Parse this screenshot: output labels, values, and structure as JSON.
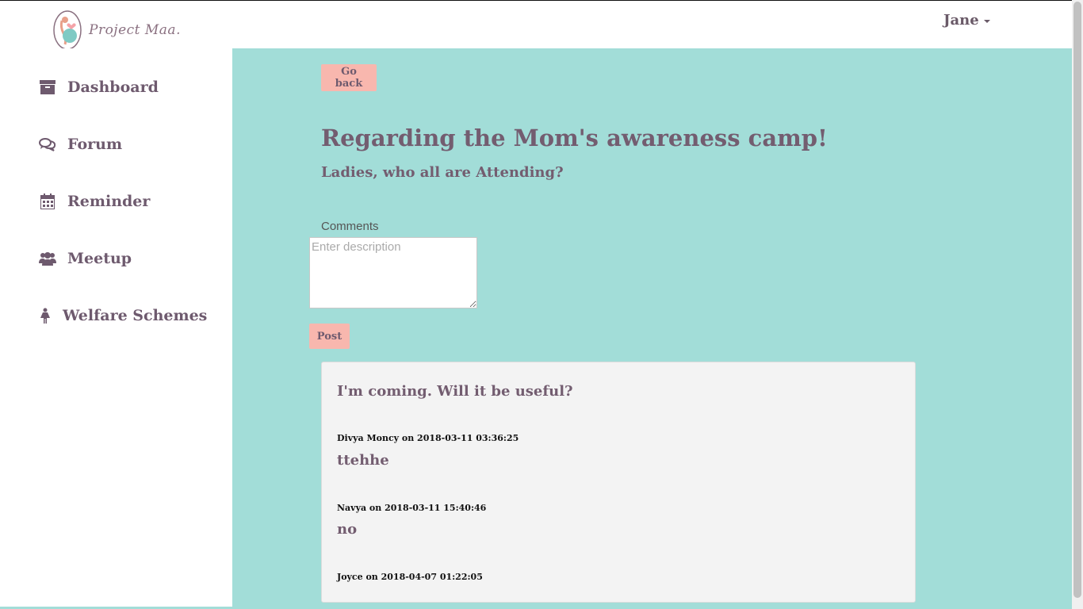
{
  "header": {
    "logo_text": "Project Maa.",
    "user_name": "Jane"
  },
  "sidebar": {
    "items": [
      {
        "label": "Dashboard",
        "icon": "archive-icon"
      },
      {
        "label": "Forum",
        "icon": "comments-icon"
      },
      {
        "label": "Reminder",
        "icon": "calendar-icon"
      },
      {
        "label": "Meetup",
        "icon": "users-icon"
      },
      {
        "label": "Welfare Schemes",
        "icon": "female-icon"
      }
    ]
  },
  "main": {
    "back_button": "Go back",
    "post_title": "Regarding the Mom's awareness camp!",
    "post_subtitle": "Ladies, who all are Attending?",
    "comments_label": "Comments",
    "comment_placeholder": "Enter description",
    "post_button": "Post",
    "thread": {
      "title": "I'm coming. Will it be useful?",
      "comments": [
        {
          "meta": "Divya Moncy on 2018-03-11 03:36:25",
          "body": "ttehhe"
        },
        {
          "meta": "Navya on 2018-03-11 15:40:46",
          "body": "no"
        },
        {
          "meta": "Joyce on 2018-04-07 01:22:05",
          "body": ""
        }
      ]
    }
  },
  "colors": {
    "main_bg": "#a2ddd8",
    "accent_button": "#f8b7ae",
    "text_primary": "#735d70",
    "card_bg": "#f3f3f3"
  }
}
